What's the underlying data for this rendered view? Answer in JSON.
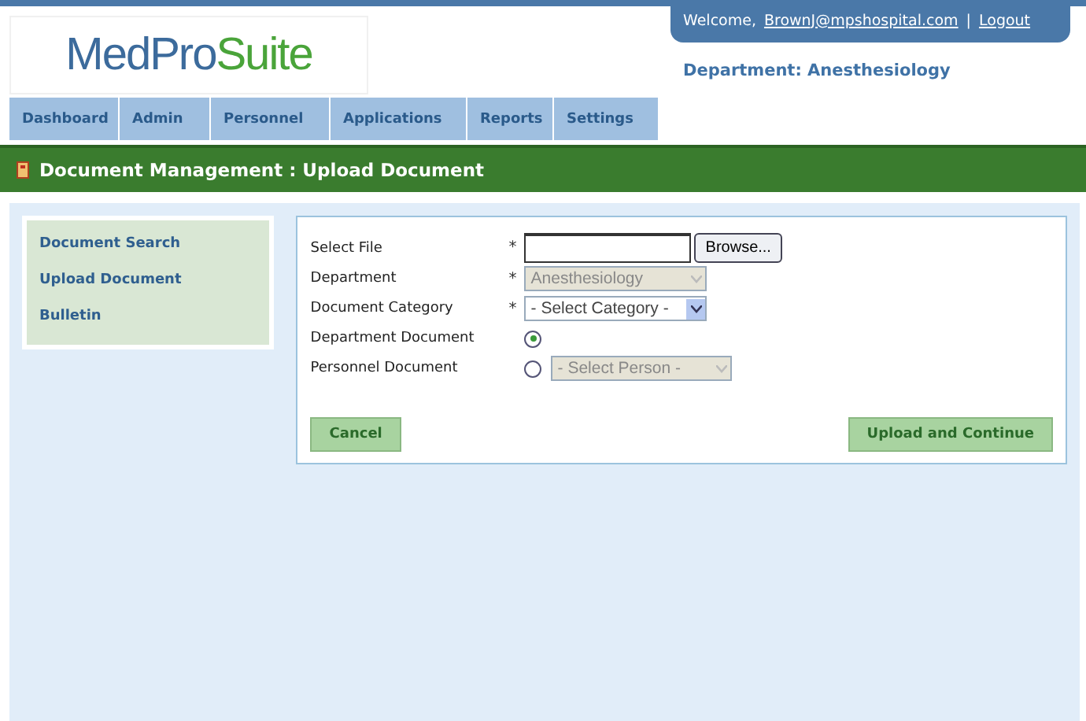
{
  "header": {
    "logo": {
      "first": "MedPro",
      "second": "Suite"
    },
    "welcome": "Welcome,",
    "user": "BrownJ@mpshospital.com",
    "separator": "|",
    "logout": "Logout",
    "department": "Department: Anesthesiology"
  },
  "tabs": [
    {
      "label": "Dashboard",
      "selected": false
    },
    {
      "label": "Admin",
      "selected": false
    },
    {
      "label": "Personnel",
      "selected": false
    },
    {
      "label": "Applications",
      "selected": false
    },
    {
      "label": "Reports",
      "selected": false
    },
    {
      "label": "Settings",
      "selected": false
    }
  ],
  "page_title": "Document Management : Upload Document",
  "sidebar": {
    "items": [
      {
        "label": "Document Search",
        "selected": false
      },
      {
        "label": "Upload Document",
        "selected": false
      },
      {
        "label": "Bulletin",
        "selected": false
      }
    ]
  },
  "form": {
    "fields": [
      {
        "kind": "file",
        "label": "Select File",
        "required": true,
        "button": "Browse..."
      },
      {
        "kind": "select",
        "label": "Department",
        "required": true,
        "value": "Anesthesiology",
        "disabled": true
      },
      {
        "kind": "select",
        "label": "Document Category",
        "required": true,
        "value": "- Select Category -",
        "disabled": false
      },
      {
        "kind": "radio",
        "label": "Department Document",
        "required": false,
        "selected": true
      },
      {
        "kind": "radio",
        "label": "Personnel Document",
        "required": false,
        "selected": false,
        "select": {
          "value": "- Select Person -",
          "disabled": true
        }
      }
    ],
    "required_mark": "*",
    "cancel": "Cancel",
    "submit": "Upload and Continue"
  }
}
